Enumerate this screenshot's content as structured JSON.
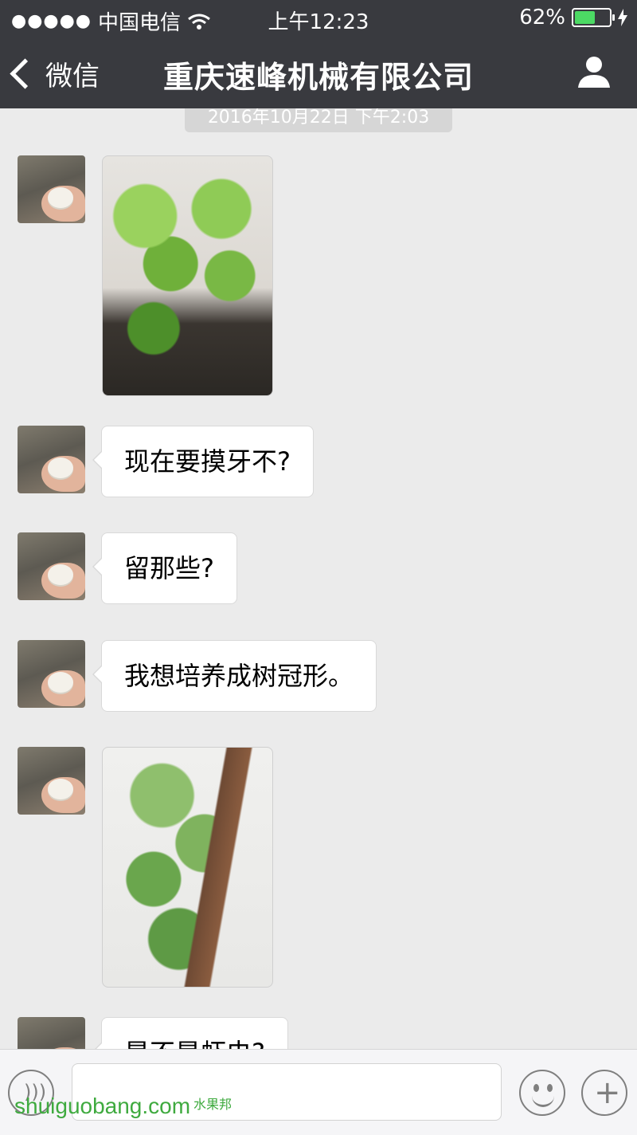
{
  "status_bar": {
    "signal": "●●●●●",
    "carrier": "中国电信",
    "time": "上午12:23",
    "battery_percent": "62%",
    "battery_level": 0.62
  },
  "nav": {
    "back_label": "微信",
    "title": "重庆速峰机械有限公司"
  },
  "chat": {
    "timestamp": "2016年10月22日 下午2:03",
    "messages": [
      {
        "type": "image"
      },
      {
        "type": "text",
        "text": "现在要摸牙不?"
      },
      {
        "type": "text",
        "text": "留那些?"
      },
      {
        "type": "text",
        "text": "我想培养成树冠形。"
      },
      {
        "type": "image"
      },
      {
        "type": "text",
        "text": "是不是虾虫?"
      }
    ]
  },
  "input_bar": {
    "voice_icon": "voice-icon",
    "emoji_icon": "emoji-icon",
    "plus_icon": "plus-icon"
  },
  "watermark": {
    "text": "shuiguobang.com",
    "cn": "水果邦"
  },
  "colors": {
    "nav_bg": "#393a3f",
    "chat_bg": "#ebebeb",
    "battery": "#4cd964"
  }
}
